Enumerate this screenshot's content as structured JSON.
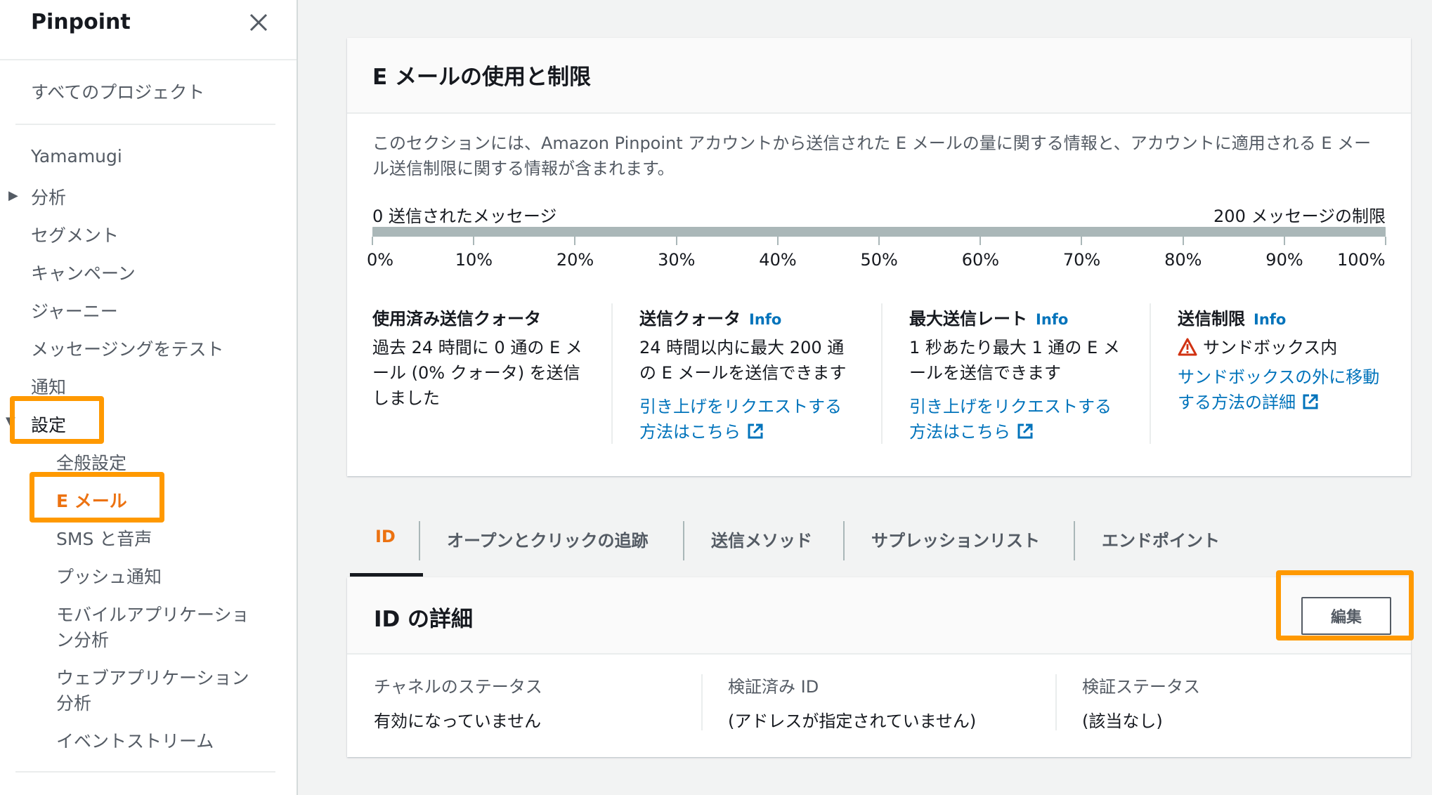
{
  "sidebar": {
    "title": "Pinpoint",
    "all_projects": "すべてのプロジェクト",
    "project": "Yamamugi",
    "items": [
      {
        "label": "分析",
        "caret": "▶"
      },
      {
        "label": "セグメント"
      },
      {
        "label": "キャンペーン"
      },
      {
        "label": "ジャーニー"
      },
      {
        "label": "メッセージングをテスト"
      },
      {
        "label": "通知"
      },
      {
        "label": "設定",
        "caret": "▼"
      }
    ],
    "settings_items": [
      {
        "label": "全般設定"
      },
      {
        "label": "E メール"
      },
      {
        "label": "SMS と音声"
      },
      {
        "label": "プッシュ通知"
      },
      {
        "label": "モバイルアプリケーショ"
      },
      {
        "label": "ン分析"
      },
      {
        "label": "ウェブアプリケーション"
      },
      {
        "label": "分析"
      },
      {
        "label": "イベントストリーム"
      }
    ]
  },
  "usage": {
    "title": "E メールの使用と制限",
    "description": "このセクションには、Amazon Pinpoint アカウントから送信された E メールの量に関する情報と、アカウントに適用される E メール送信制限に関する情報が含まれます。",
    "bar_left": "0 送信されたメッセージ",
    "bar_right": "200 メッセージの制限",
    "progress": 0,
    "ticks": [
      "0%",
      "10%",
      "20%",
      "30%",
      "40%",
      "50%",
      "60%",
      "70%",
      "80%",
      "90%",
      "100%"
    ],
    "columns": [
      {
        "title": "使用済み送信クォータ",
        "body": "過去 24 時間に 0 通の E メール (0% クォータ) を送信しました"
      },
      {
        "title": "送信クォータ",
        "info": "Info",
        "body": "24 時間以内に最大 200 通の E メールを送信できます",
        "link": "引き上げをリクエストする方法はこちら"
      },
      {
        "title": "最大送信レート",
        "info": "Info",
        "body": "1 秒あたり最大 1 通の E メールを送信できます",
        "link": "引き上げをリクエストする方法はこちら"
      },
      {
        "title": "送信制限",
        "info": "Info",
        "body": "サンドボックス内",
        "link": "サンドボックスの外に移動する方法の詳細"
      }
    ]
  },
  "tabs": [
    {
      "label": "ID"
    },
    {
      "label": "オープンとクリックの追跡"
    },
    {
      "label": "送信メソッド"
    },
    {
      "label": "サプレッションリスト"
    },
    {
      "label": "エンドポイント"
    }
  ],
  "identity": {
    "title": "ID の詳細",
    "edit_label": "編集",
    "fields": [
      {
        "label": "チャネルのステータス",
        "value": "有効になっていません"
      },
      {
        "label": "検証済み ID",
        "value": "(アドレスが指定されていません)"
      },
      {
        "label": "検証ステータス",
        "value": "(該当なし)"
      }
    ]
  },
  "colors": {
    "accent": "#ec7211",
    "highlight": "#ff9900",
    "link": "#0073bb",
    "warning": "#d13212"
  }
}
